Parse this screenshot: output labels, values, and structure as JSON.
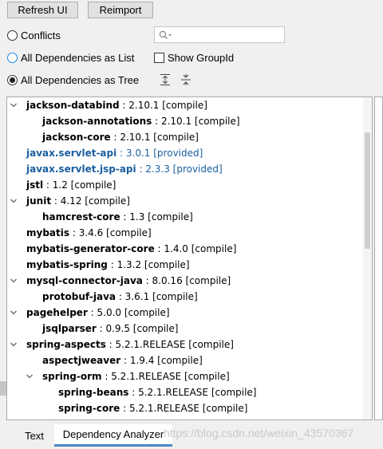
{
  "toolbar": {
    "refresh_label": "Refresh UI",
    "reimport_label": "Reimport"
  },
  "filters": {
    "conflicts_label": "Conflicts",
    "all_list_label": "All Dependencies as List",
    "all_tree_label": "All Dependencies as Tree",
    "show_groupid_label": "Show GroupId",
    "selected": "All Dependencies as Tree",
    "show_groupid_checked": false
  },
  "tree": {
    "rows": [
      {
        "name": "jackson-databind",
        "meta": ": 2.10.1 [compile]",
        "expander": "down"
      },
      {
        "name": "jackson-annotations",
        "meta": ": 2.10.1 [compile]"
      },
      {
        "name": "jackson-core",
        "meta": ": 2.10.1 [compile]"
      },
      {
        "name": "javax.servlet-api",
        "meta": ": 3.0.1 [provided]",
        "scope": "provided"
      },
      {
        "name": "javax.servlet.jsp-api",
        "meta": ": 2.3.3 [provided]",
        "scope": "provided"
      },
      {
        "name": "jstl",
        "meta": ": 1.2 [compile]"
      },
      {
        "name": "junit",
        "meta": ": 4.12 [compile]",
        "expander": "down"
      },
      {
        "name": "hamcrest-core",
        "meta": ": 1.3 [compile]"
      },
      {
        "name": "mybatis",
        "meta": ": 3.4.6 [compile]"
      },
      {
        "name": "mybatis-generator-core",
        "meta": ": 1.4.0 [compile]"
      },
      {
        "name": "mybatis-spring",
        "meta": ": 1.3.2 [compile]"
      },
      {
        "name": "mysql-connector-java",
        "meta": ": 8.0.16 [compile]",
        "expander": "down"
      },
      {
        "name": "protobuf-java",
        "meta": ": 3.6.1 [compile]"
      },
      {
        "name": "pagehelper",
        "meta": ": 5.0.0 [compile]",
        "expander": "down"
      },
      {
        "name": "jsqlparser",
        "meta": ": 0.9.5 [compile]"
      },
      {
        "name": "spring-aspects",
        "meta": ": 5.2.1.RELEASE [compile]",
        "expander": "down"
      },
      {
        "name": "aspectjweaver",
        "meta": ": 1.9.4 [compile]"
      },
      {
        "name": "spring-orm",
        "meta": ": 5.2.1.RELEASE [compile]",
        "expander": "down"
      },
      {
        "name": "spring-beans",
        "meta": ": 5.2.1.RELEASE [compile]"
      },
      {
        "name": "spring-core",
        "meta": ": 5.2.1.RELEASE [compile]"
      }
    ]
  },
  "tabs": {
    "text_label": "Text",
    "analyzer_label": "Dependency Analyzer",
    "active": "Dependency Analyzer"
  },
  "watermark": "https://blog.csdn.net/weixin_43570367",
  "colors": {
    "provided": "#1a5fa0",
    "active_tab_underline": "#4a86c8"
  }
}
